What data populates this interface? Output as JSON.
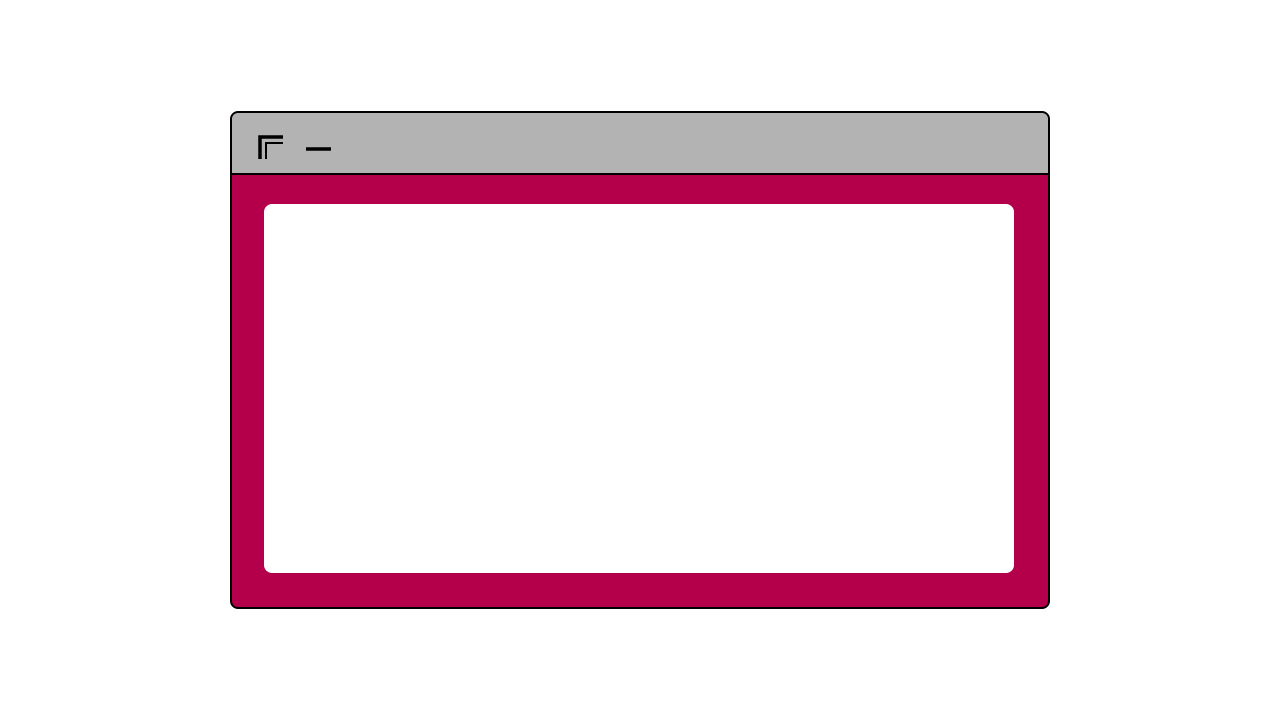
{
  "window": {
    "title_bar": {
      "controls": [
        {
          "icon": "restore-icon"
        },
        {
          "icon": "minimize-icon"
        }
      ]
    },
    "colors": {
      "title_bar": "#b3b3b3",
      "frame": "#b4004a",
      "content": "#ffffff",
      "border": "#000000"
    }
  }
}
